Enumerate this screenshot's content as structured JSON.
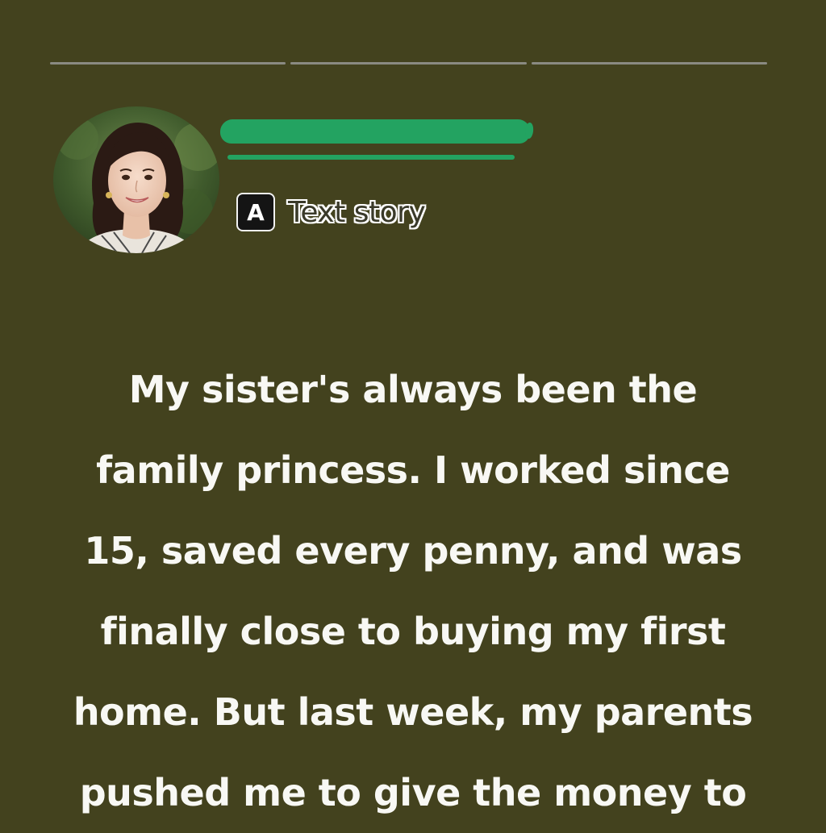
{
  "story": {
    "progress": [
      1.0,
      1.0,
      1.0
    ],
    "tag": {
      "icon": "text-a-icon",
      "icon_letter": "A",
      "label": "Text story"
    },
    "lines": [
      "My sister's always been the",
      "family princess. I worked since",
      "15, saved every penny, and was",
      "finally close to buying my first",
      "home. But last week, my parents",
      "pushed me to give the money to"
    ]
  },
  "colors": {
    "background": "#43421e",
    "redaction": "#23a361",
    "text": "#f8f8f4"
  }
}
